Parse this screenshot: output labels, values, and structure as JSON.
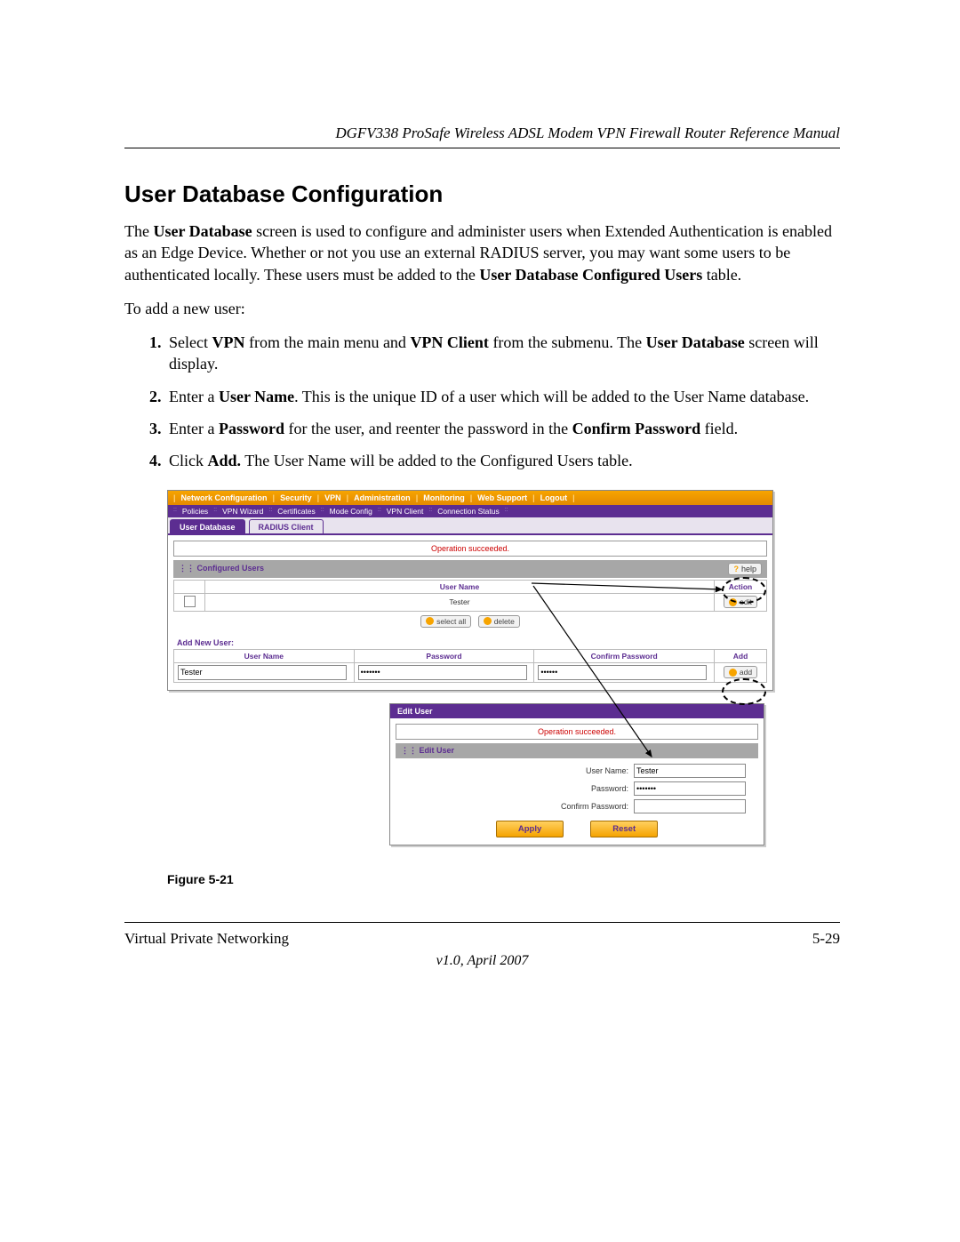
{
  "header": {
    "running": "DGFV338 ProSafe Wireless ADSL Modem VPN Firewall Router Reference Manual"
  },
  "section": {
    "title": "User Database Configuration",
    "intro_parts": {
      "pre1": "The ",
      "b1": "User Database",
      "mid1": " screen is used to configure and administer users when Extended Authentication is enabled as an Edge Device. Whether or not you use an external RADIUS server, you may want some users to be authenticated locally. These users must be added to the ",
      "b2": "User Database Configured Users",
      "post1": " table."
    },
    "lead": "To add a new user:",
    "steps": [
      {
        "pre": "Select ",
        "b1": "VPN",
        "mid1": " from the main menu and ",
        "b2": "VPN Client",
        "mid2": " from the submenu. The ",
        "b3": "User Database",
        "post": " screen will display."
      },
      {
        "pre": "Enter a ",
        "b1": "User Name",
        "post": ". This is the unique ID of a user which will be added to the User Name database."
      },
      {
        "pre": "Enter a ",
        "b1": "Password",
        "mid1": " for the user, and reenter the password in the ",
        "b2": "Confirm Password",
        "post": " field."
      },
      {
        "pre": "Click ",
        "b1": "Add.",
        "post": " The User Name will be added to the Configured Users table."
      }
    ],
    "figure_caption": "Figure 5-21"
  },
  "screenshot1": {
    "menu": [
      "Network Configuration",
      "Security",
      "VPN",
      "Administration",
      "Monitoring",
      "Web Support",
      "Logout"
    ],
    "submenu": [
      "Policies",
      "VPN Wizard",
      "Certificates",
      "Mode Config",
      "VPN Client",
      "Connection Status"
    ],
    "tabs": {
      "active": "User Database",
      "other": "RADIUS Client"
    },
    "status": "Operation succeeded.",
    "configured_users": {
      "title": "Configured Users",
      "help": "help",
      "col_user": "User Name",
      "col_action": "Action",
      "row_user": "Tester",
      "row_action": "edit",
      "btn_selectall": "select all",
      "btn_delete": "delete"
    },
    "add_new": {
      "title": "Add New User:",
      "col_user": "User Name",
      "col_pass": "Password",
      "col_confirm": "Confirm Password",
      "col_add": "Add",
      "val_user": "Tester",
      "val_pass": "•••••••",
      "val_confirm": "••••••",
      "btn_add": "add"
    }
  },
  "screenshot2": {
    "title": "Edit User",
    "status": "Operation succeeded.",
    "panel": "Edit User",
    "lbl_user": "User Name:",
    "val_user": "Tester",
    "lbl_pass": "Password:",
    "val_pass": "•••••••",
    "lbl_confirm": "Confirm Password:",
    "val_confirm": "",
    "btn_apply": "Apply",
    "btn_reset": "Reset"
  },
  "footer": {
    "left": "Virtual Private Networking",
    "right": "5-29",
    "version": "v1.0, April 2007"
  }
}
